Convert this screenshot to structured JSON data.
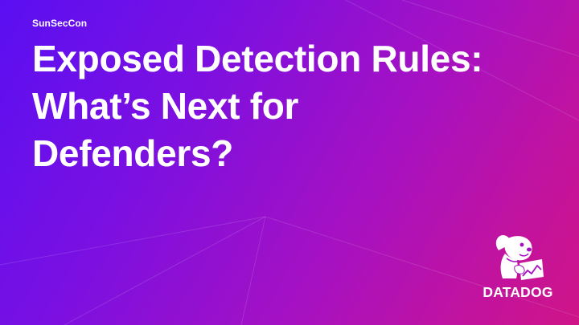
{
  "slide": {
    "event": "SunSecCon",
    "title_lines": [
      "Exposed Detection Rules:",
      "What’s Next for",
      "Defenders?"
    ]
  },
  "branding": {
    "wordmark": "DATADOG",
    "logo_icon": "datadog-dog-icon"
  },
  "colors": {
    "gradient_start": "#5a0ff2",
    "gradient_mid": "#a611c2",
    "gradient_end": "#cf1487",
    "text": "#ffffff"
  }
}
